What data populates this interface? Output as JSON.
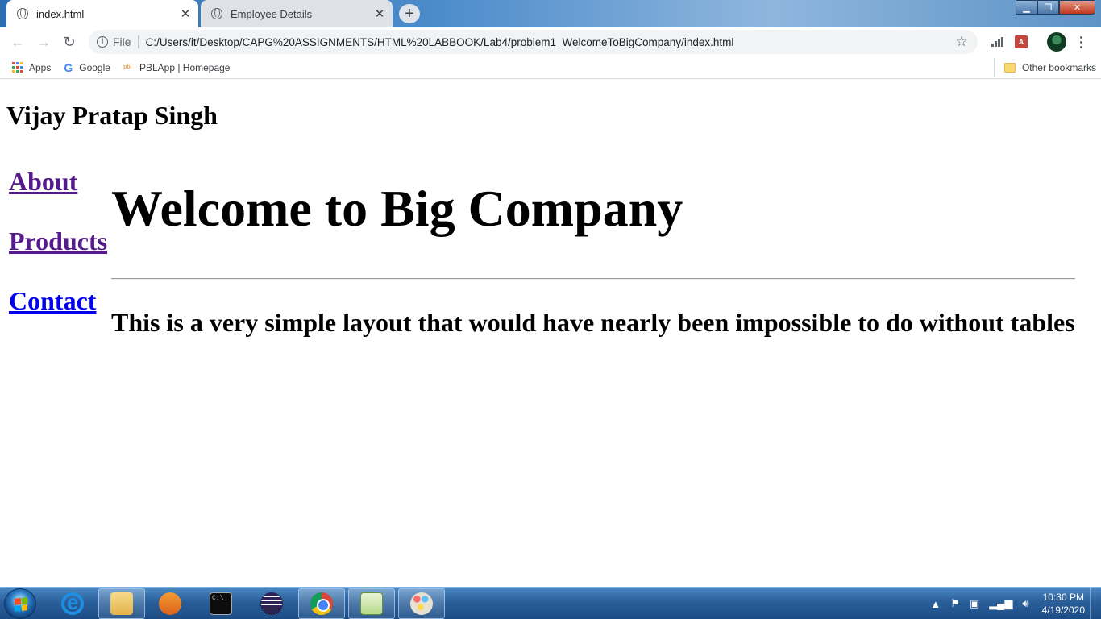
{
  "browser": {
    "tabs": [
      {
        "title": "index.html",
        "active": true
      },
      {
        "title": "Employee Details",
        "active": false
      }
    ],
    "new_tab_symbol": "+",
    "address_bar": {
      "scheme_label": "File",
      "url": "C:/Users/it/Desktop/CAPG%20ASSIGNMENTS/HTML%20LABBOOK/Lab4/problem1_WelcomeToBigCompany/index.html"
    },
    "bookmarks": [
      {
        "label": "Apps",
        "icon": "apps-grid-icon"
      },
      {
        "label": "Google",
        "icon": "google-icon"
      },
      {
        "label": "PBLApp | Homepage",
        "icon": "pbl-icon"
      }
    ],
    "other_bookmarks": "Other bookmarks"
  },
  "page": {
    "author": "Vijay Pratap Singh",
    "nav": [
      {
        "label": "About",
        "visited": true
      },
      {
        "label": "Products",
        "visited": true
      },
      {
        "label": "Contact",
        "visited": false
      }
    ],
    "heading": "Welcome to Big Company",
    "tagline": "This is a very simple layout that would have nearly been impossible to do without tables"
  },
  "taskbar": {
    "pinned": [
      "internet-explorer-icon",
      "file-explorer-icon",
      "media-player-icon",
      "command-prompt-icon",
      "eclipse-icon",
      "chrome-icon",
      "notepad-plus-plus-icon",
      "paint-icon"
    ],
    "clock": {
      "time": "10:30 PM",
      "date": "4/19/2020"
    }
  },
  "colors": {
    "visited_link": "#551a8b",
    "unvisited_link": "#0000ee",
    "taskbar": "#2a5f9a"
  }
}
